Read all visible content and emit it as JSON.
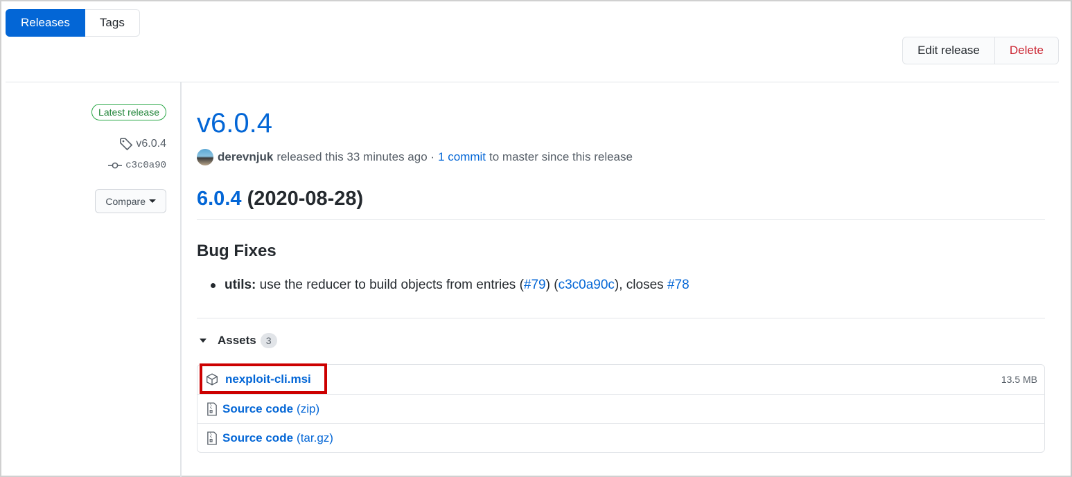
{
  "tabs": {
    "releases": "Releases",
    "tags": "Tags"
  },
  "actions": {
    "edit": "Edit release",
    "delete": "Delete"
  },
  "meta": {
    "latest_badge": "Latest release",
    "tag": "v6.0.4",
    "commit": "c3c0a90",
    "compare": "Compare"
  },
  "release": {
    "title": "v6.0.4",
    "author": "derevnjuk",
    "released_text": "released this 33 minutes ago ·",
    "commits_link": "1 commit",
    "since_text": "to master since this release"
  },
  "body": {
    "heading_link": "6.0.4",
    "heading_date": "(2020-08-28)",
    "bug_heading": "Bug Fixes",
    "bullet": {
      "scope": "utils:",
      "text": "use the reducer to build objects from entries (",
      "pr_link": "#79",
      "mid": ") (",
      "commit_link": "c3c0a90c",
      "closes": "), closes",
      "issue_link": "#78"
    }
  },
  "assets": {
    "label": "Assets",
    "count": "3",
    "items": [
      {
        "name": "nexploit-cli.msi",
        "size": "13.5 MB",
        "icon": "package-icon"
      },
      {
        "name": "Source code",
        "ext": "(zip)",
        "icon": "file-zip-icon"
      },
      {
        "name": "Source code",
        "ext": "(tar.gz)",
        "icon": "file-zip-icon"
      }
    ]
  },
  "colors": {
    "accent": "#0366d6",
    "danger": "#cb2431",
    "success": "#28a745",
    "highlight": "#cc0000"
  }
}
